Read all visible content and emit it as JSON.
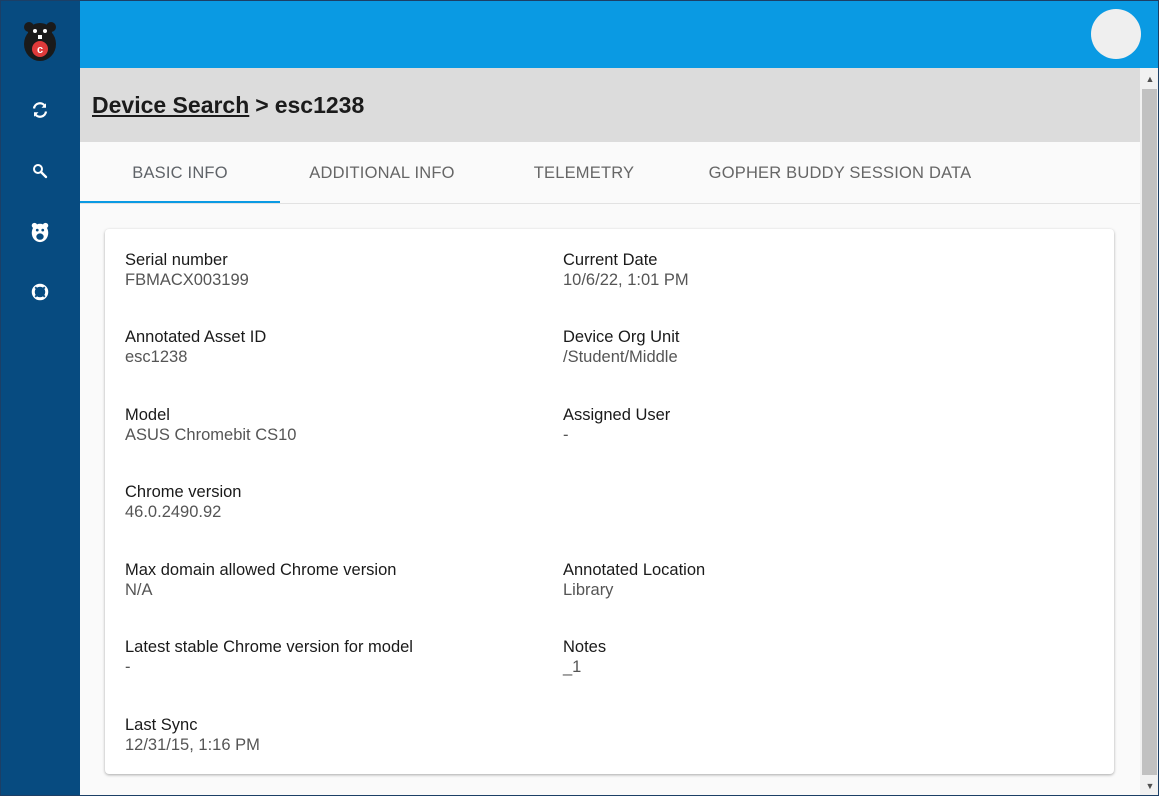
{
  "sidebar": {
    "items": [
      {
        "icon": "sync-icon"
      },
      {
        "icon": "search-icon"
      },
      {
        "icon": "gopher-icon"
      },
      {
        "icon": "lifebuoy-icon"
      }
    ]
  },
  "breadcrumb": {
    "link": "Device Search",
    "separator": ">",
    "current": "esc1238"
  },
  "tabs": [
    {
      "label": "BASIC INFO",
      "active": true
    },
    {
      "label": "ADDITIONAL INFO",
      "active": false
    },
    {
      "label": "TELEMETRY",
      "active": false
    },
    {
      "label": "GOPHER BUDDY SESSION DATA",
      "active": false
    }
  ],
  "fields": {
    "serial_number": {
      "label": "Serial number",
      "value": "FBMACX003199"
    },
    "current_date": {
      "label": "Current Date",
      "value": "10/6/22, 1:01 PM"
    },
    "annotated_asset_id": {
      "label": "Annotated Asset ID",
      "value": "esc1238"
    },
    "device_org_unit": {
      "label": "Device Org Unit",
      "value": "/Student/Middle"
    },
    "model": {
      "label": "Model",
      "value": "ASUS Chromebit CS10"
    },
    "assigned_user": {
      "label": "Assigned User",
      "value": "-"
    },
    "chrome_version": {
      "label": "Chrome version",
      "value": "46.0.2490.92"
    },
    "max_domain_chrome": {
      "label": "Max domain allowed Chrome version",
      "value": "N/A"
    },
    "annotated_location": {
      "label": "Annotated Location",
      "value": "Library"
    },
    "latest_stable_chrome": {
      "label": "Latest stable Chrome version for model",
      "value": "-"
    },
    "notes": {
      "label": "Notes",
      "value": "_1"
    },
    "last_sync": {
      "label": "Last Sync",
      "value": "12/31/15, 1:16 PM"
    }
  },
  "colors": {
    "sidebar": "#074b80",
    "topbar": "#0a9ae3",
    "accent": "#0a9ae3"
  }
}
